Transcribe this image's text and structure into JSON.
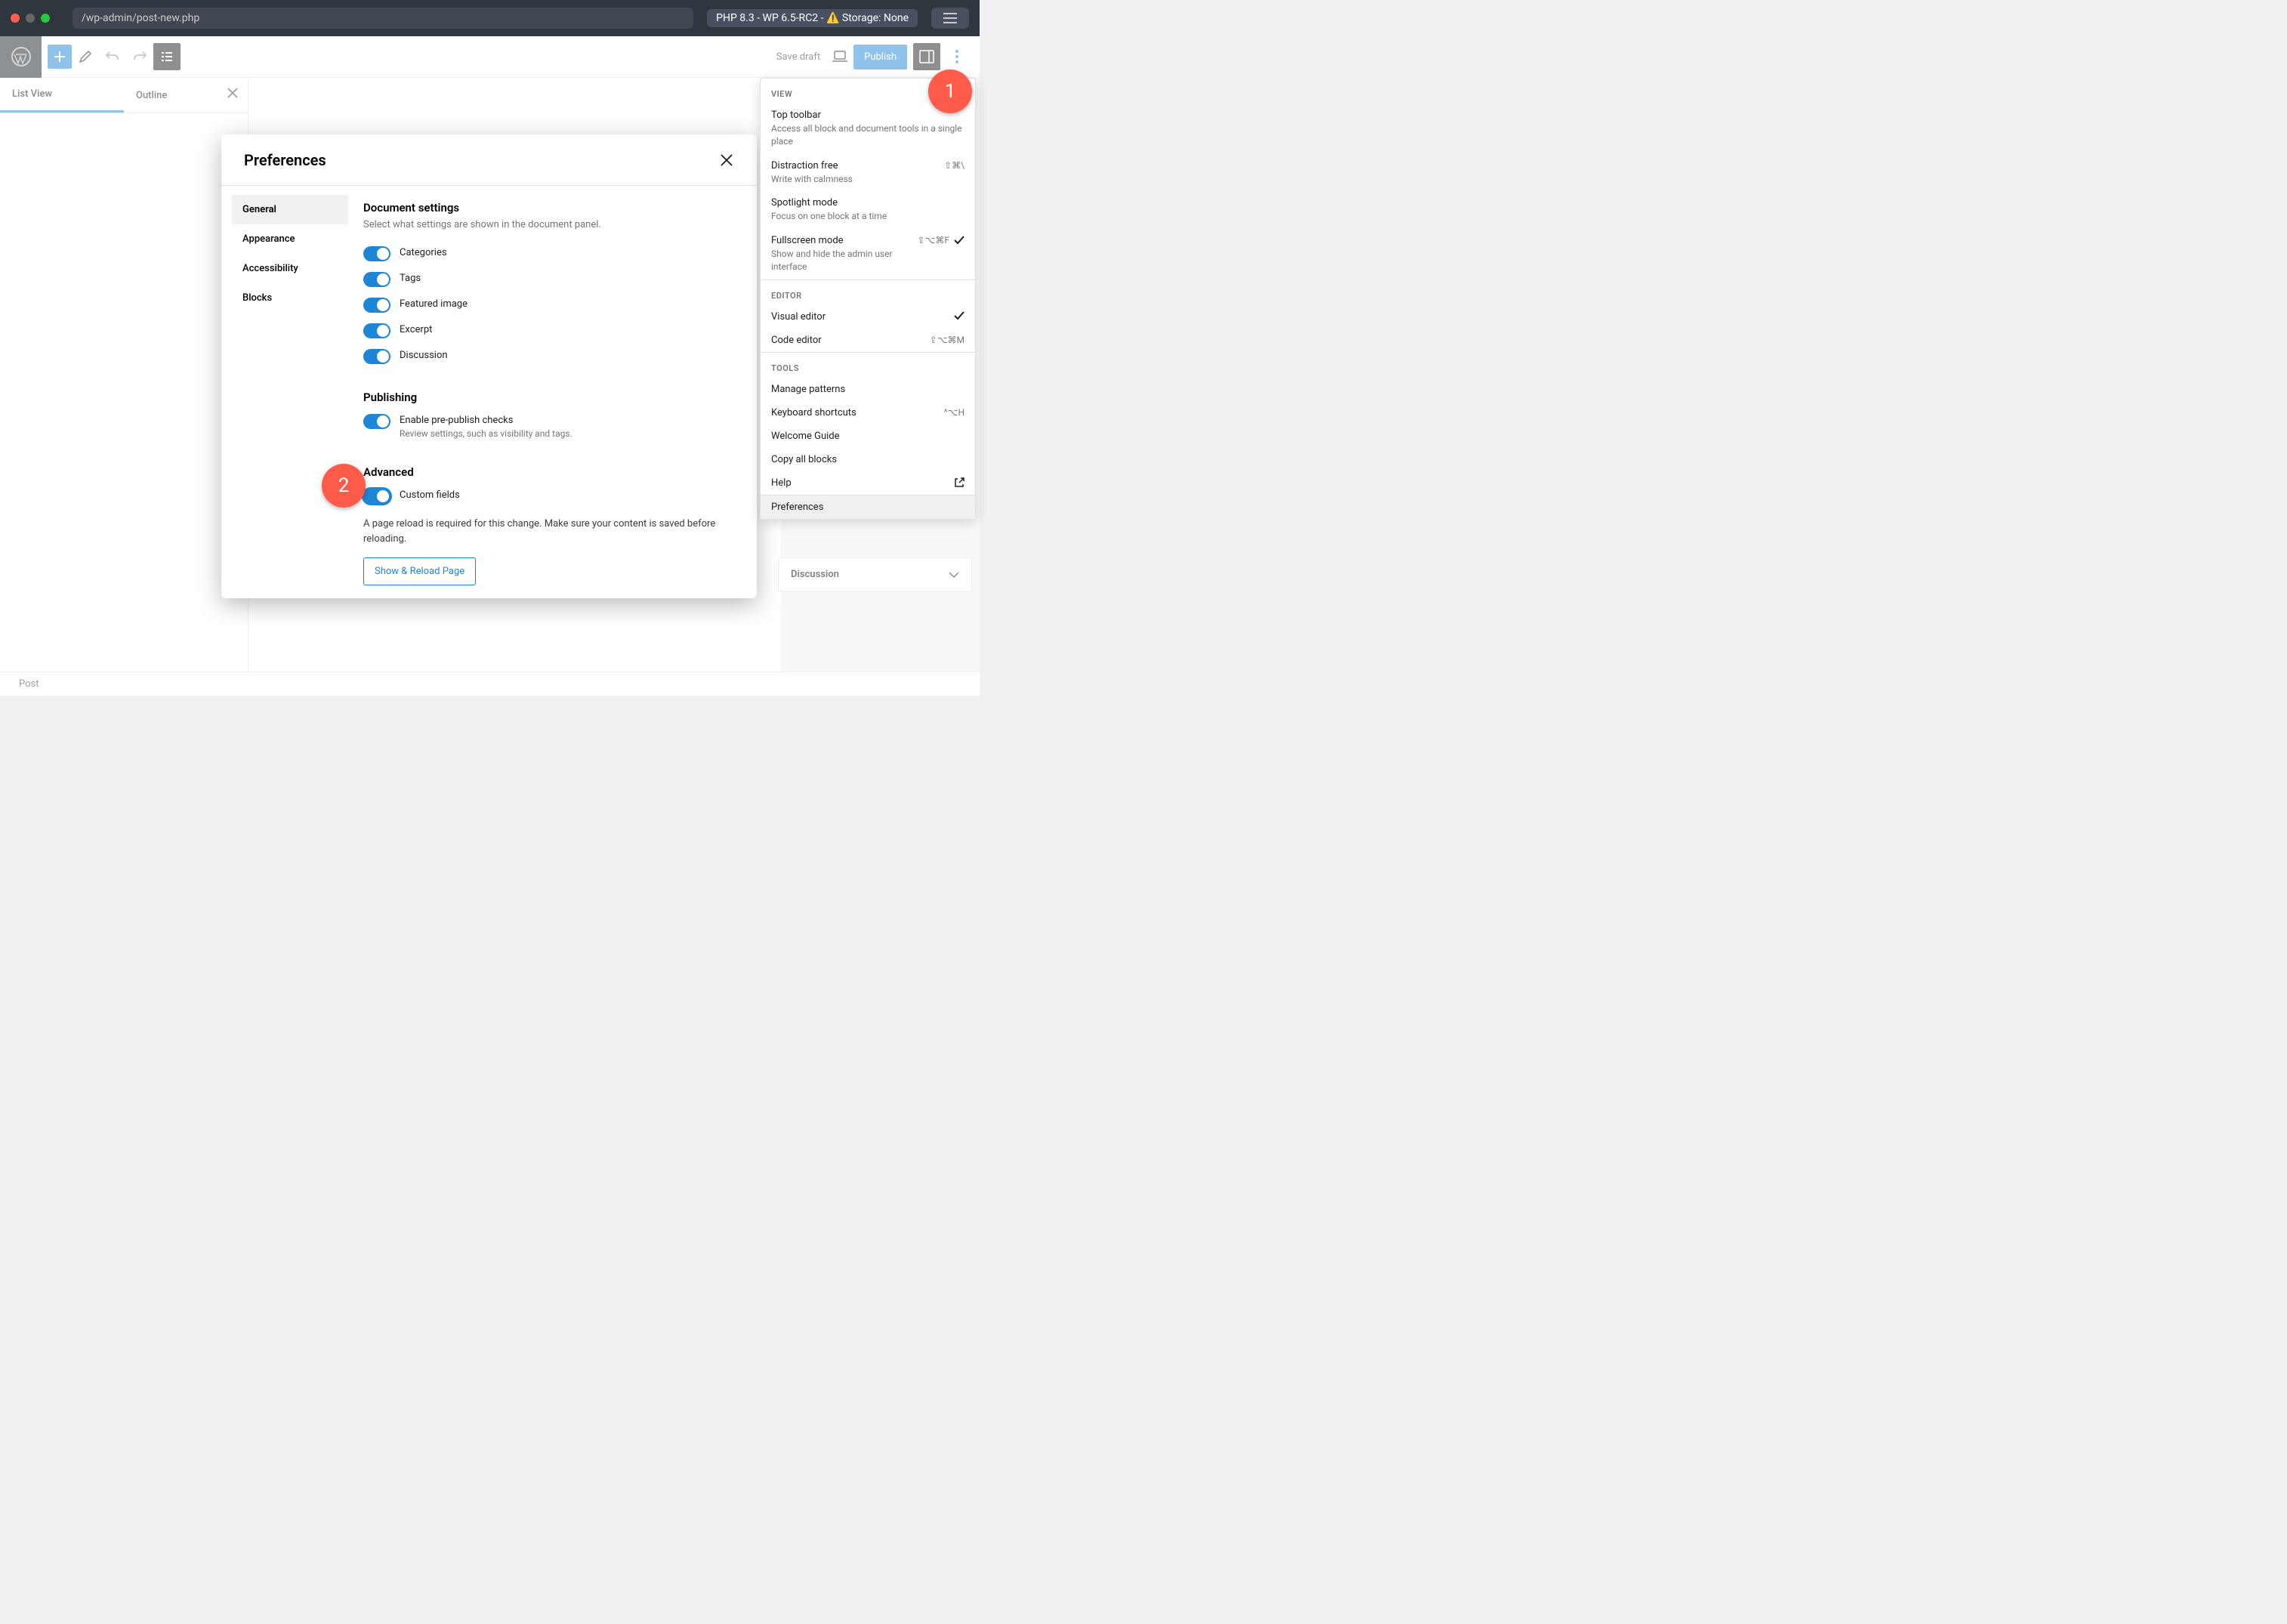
{
  "browser": {
    "url": "/wp-admin/post-new.php",
    "env_badge": "PHP 8.3 - WP 6.5-RC2 - ⚠️ Storage: None"
  },
  "toolbar": {
    "save_draft": "Save draft",
    "publish": "Publish"
  },
  "secondary_tabs": {
    "list_view": "List View",
    "outline": "Outline"
  },
  "bottom_bar": {
    "breadcrumb": "Post"
  },
  "right_panel": {
    "discussion": "Discussion"
  },
  "options_menu": {
    "sections": {
      "view": "View",
      "editor": "Editor",
      "tools": "Tools"
    },
    "items": {
      "top_toolbar": {
        "title": "Top toolbar",
        "desc": "Access all block and document tools in a single place"
      },
      "distraction_free": {
        "title": "Distraction free",
        "desc": "Write with calmness",
        "shortcut": "⇧⌘\\"
      },
      "spotlight": {
        "title": "Spotlight mode",
        "desc": "Focus on one block at a time"
      },
      "fullscreen": {
        "title": "Fullscreen mode",
        "desc": "Show and hide the admin user interface",
        "shortcut": "⇧⌥⌘F",
        "checked": true
      },
      "visual_editor": {
        "title": "Visual editor",
        "checked": true
      },
      "code_editor": {
        "title": "Code editor",
        "shortcut": "⇧⌥⌘M"
      },
      "manage_patterns": {
        "title": "Manage patterns"
      },
      "keyboard_shortcuts": {
        "title": "Keyboard shortcuts",
        "shortcut": "^⌥H"
      },
      "welcome_guide": {
        "title": "Welcome Guide"
      },
      "copy_all_blocks": {
        "title": "Copy all blocks"
      },
      "help": {
        "title": "Help"
      },
      "preferences": {
        "title": "Preferences"
      }
    }
  },
  "modal": {
    "title": "Preferences",
    "nav": {
      "general": "General",
      "appearance": "Appearance",
      "accessibility": "Accessibility",
      "blocks": "Blocks"
    },
    "sections": {
      "doc_settings": {
        "title": "Document settings",
        "desc": "Select what settings are shown in the document panel.",
        "toggles": {
          "categories": "Categories",
          "tags": "Tags",
          "featured_image": "Featured image",
          "excerpt": "Excerpt",
          "discussion": "Discussion"
        }
      },
      "publishing": {
        "title": "Publishing",
        "toggle": {
          "label": "Enable pre-publish checks",
          "sub": "Review settings, such as visibility and tags."
        }
      },
      "advanced": {
        "title": "Advanced",
        "toggle": {
          "label": "Custom fields"
        },
        "note": "A page reload is required for this change. Make sure your content is saved before reloading.",
        "button": "Show & Reload Page"
      }
    }
  },
  "annotations": {
    "one": "1",
    "two": "2"
  }
}
